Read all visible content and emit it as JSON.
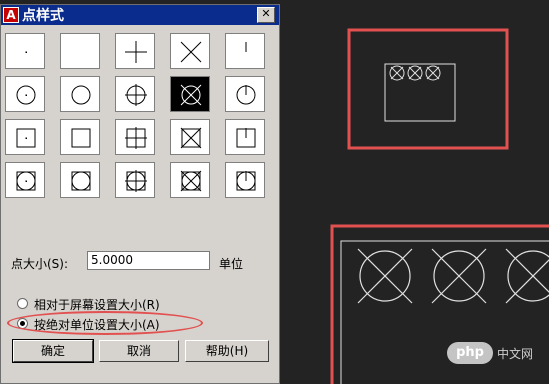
{
  "dialog": {
    "title": "点样式",
    "app_icon": "A",
    "close_glyph": "✕",
    "point_size_label": "点大小(S):",
    "point_size_value": "5.0000",
    "unit_label": "单位",
    "radio_relative": "相对于屏幕设置大小(R)",
    "radio_absolute": "按绝对单位设置大小(A)",
    "selected_radio": "absolute",
    "buttons": {
      "ok": "确定",
      "cancel": "取消",
      "help": "帮助(H)"
    },
    "selected_style_index": 8
  },
  "point_styles": [
    "dot",
    "none",
    "plus",
    "x",
    "tick",
    "circle-dot",
    "circle",
    "circle-plus",
    "circle-x",
    "circle-tick",
    "square-dot",
    "square",
    "square-plus",
    "square-x",
    "square-tick",
    "circlesquare-dot",
    "circlesquare",
    "circlesquare-plus",
    "circlesquare-x",
    "circlesquare-tick"
  ],
  "watermark": {
    "badge": "php",
    "text": "中文网"
  },
  "colors": {
    "highlight": "#e25050",
    "titlebar": "#0a2c8c",
    "canvas_bg": "#232323"
  }
}
